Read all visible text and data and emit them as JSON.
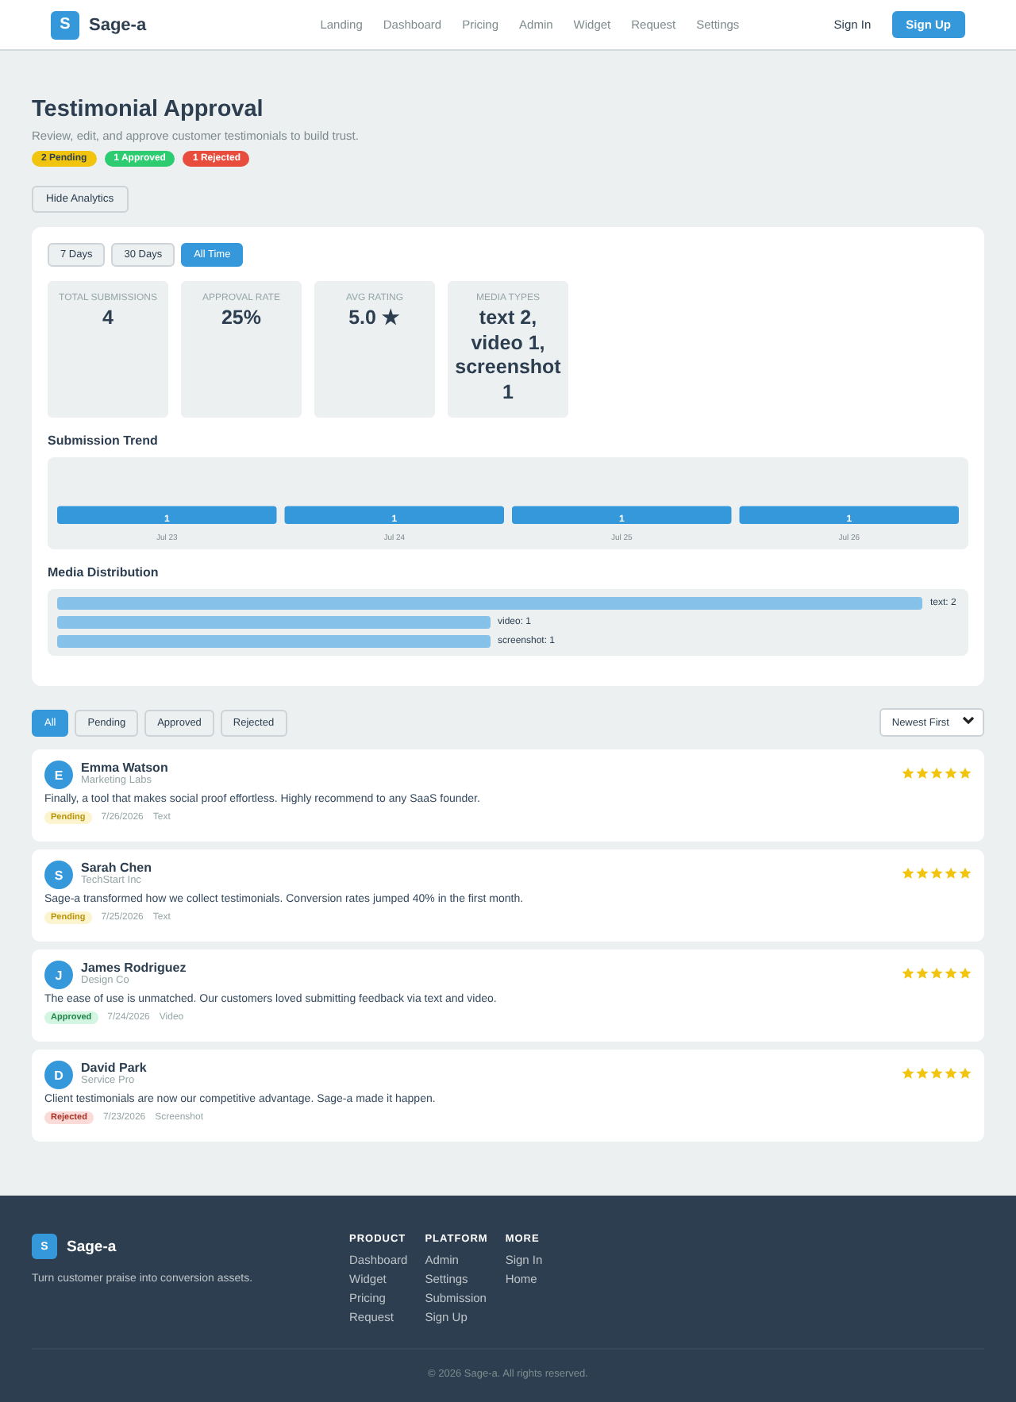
{
  "header": {
    "logo_letter": "S",
    "brand": "Sage-a",
    "nav": [
      "Landing",
      "Dashboard",
      "Pricing",
      "Admin",
      "Widget",
      "Request",
      "Settings"
    ],
    "sign_in": "Sign In",
    "sign_up": "Sign Up"
  },
  "page": {
    "title": "Testimonial Approval",
    "subtitle": "Review, edit, and approve customer testimonials to build trust.",
    "counts": [
      {
        "label": "2 Pending",
        "kind": "pending"
      },
      {
        "label": "1 Approved",
        "kind": "approved"
      },
      {
        "label": "1 Rejected",
        "kind": "rejected"
      }
    ],
    "toggle_button": "Hide Analytics"
  },
  "analytics": {
    "ranges": [
      {
        "label": "7 Days",
        "selected": false
      },
      {
        "label": "30 Days",
        "selected": false
      },
      {
        "label": "All Time",
        "selected": true
      }
    ],
    "stats": [
      {
        "label": "TOTAL SUBMISSIONS",
        "value": "4"
      },
      {
        "label": "APPROVAL RATE",
        "value": "25%"
      },
      {
        "label": "AVG RATING",
        "value": "5.0 ★"
      },
      {
        "label": "MEDIA TYPES",
        "value": "text 2, video 1, screenshot 1"
      }
    ],
    "trend": {
      "title": "Submission Trend",
      "chart_data": {
        "type": "bar",
        "categories": [
          "Jul 23",
          "Jul 24",
          "Jul 25",
          "Jul 26"
        ],
        "values": [
          1,
          1,
          1,
          1
        ],
        "data_labels": true
      }
    },
    "media": {
      "title": "Media Distribution",
      "items": [
        {
          "label": "text: 2",
          "level": 1
        },
        {
          "label": "video: 1",
          "level": 0.5
        },
        {
          "label": "screenshot: 1",
          "level": 0.5
        }
      ]
    }
  },
  "filters": [
    {
      "label": "All",
      "selected": true
    },
    {
      "label": "Pending",
      "selected": false
    },
    {
      "label": "Approved",
      "selected": false
    },
    {
      "label": "Rejected",
      "selected": false
    }
  ],
  "sort": {
    "value": "Newest First"
  },
  "testimonials": [
    {
      "initial": "E",
      "name": "Emma Watson",
      "company": "Marketing Labs",
      "stars": 5,
      "text": "Finally, a tool that makes social proof effortless. Highly recommend to any SaaS founder.",
      "kind": "pending",
      "status_label": "Pending",
      "date": "7/26/2026",
      "media": "Text"
    },
    {
      "initial": "S",
      "name": "Sarah Chen",
      "company": "TechStart Inc",
      "stars": 5,
      "text": "Sage-a transformed how we collect testimonials. Conversion rates jumped 40% in the first month.",
      "kind": "pending",
      "status_label": "Pending",
      "date": "7/25/2026",
      "media": "Text"
    },
    {
      "initial": "J",
      "name": "James Rodriguez",
      "company": "Design Co",
      "stars": 5,
      "text": "The ease of use is unmatched. Our customers loved submitting feedback via text and video.",
      "kind": "approved",
      "status_label": "Approved",
      "date": "7/24/2026",
      "media": "Video"
    },
    {
      "initial": "D",
      "name": "David Park",
      "company": "Service Pro",
      "stars": 5,
      "text": "Client testimonials are now our competitive advantage. Sage-a made it happen.",
      "kind": "rejected",
      "status_label": "Rejected",
      "date": "7/23/2026",
      "media": "Screenshot"
    }
  ],
  "footer": {
    "logo_letter": "S",
    "brand": "Sage-a",
    "tagline": "Turn customer praise into conversion assets.",
    "columns": [
      {
        "heading": "PRODUCT",
        "links": [
          "Dashboard",
          "Widget",
          "Pricing",
          "Request"
        ]
      },
      {
        "heading": "PLATFORM",
        "links": [
          "Admin",
          "Settings",
          "Submission",
          "Sign Up"
        ]
      },
      {
        "heading": "MORE",
        "links": [
          "Sign In",
          "Home"
        ]
      }
    ],
    "copyright": "© 2026 Sage-a. All rights reserved."
  }
}
